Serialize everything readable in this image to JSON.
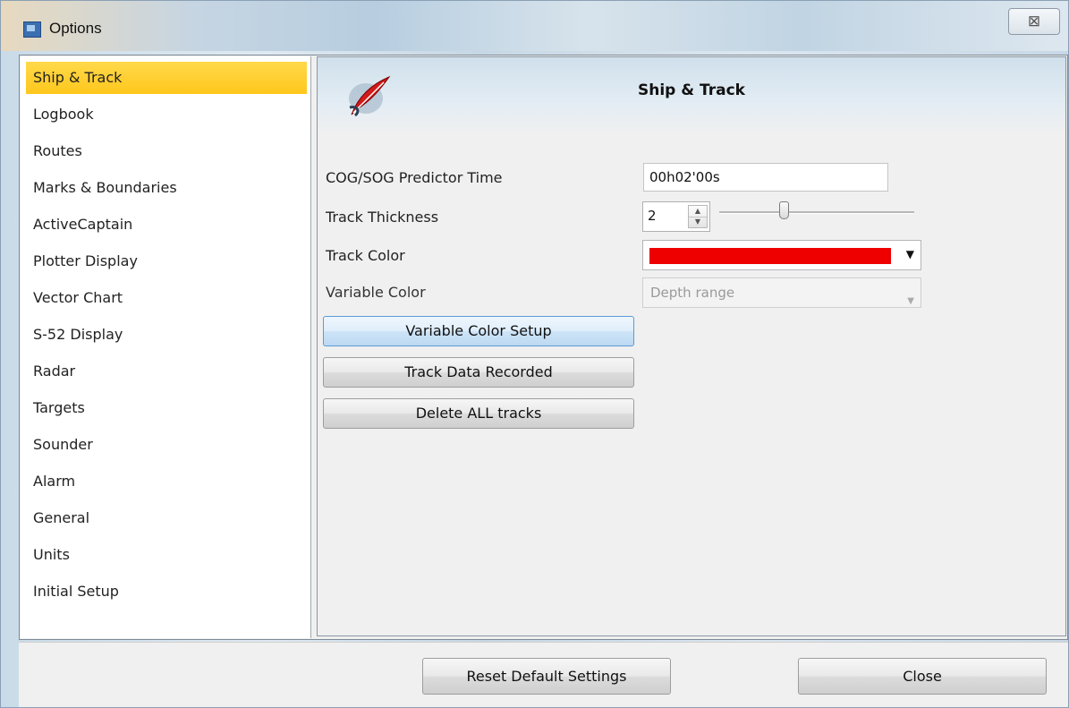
{
  "window": {
    "title": "Options",
    "close_glyph": "⊠"
  },
  "sidebar": {
    "items": [
      {
        "label": "Ship & Track",
        "selected": true
      },
      {
        "label": "Logbook"
      },
      {
        "label": "Routes"
      },
      {
        "label": "Marks & Boundaries"
      },
      {
        "label": "ActiveCaptain"
      },
      {
        "label": "Plotter Display"
      },
      {
        "label": "Vector Chart"
      },
      {
        "label": "S-52 Display"
      },
      {
        "label": "Radar"
      },
      {
        "label": "Targets"
      },
      {
        "label": "Sounder"
      },
      {
        "label": "Alarm"
      },
      {
        "label": "General"
      },
      {
        "label": "Units"
      },
      {
        "label": "Initial Setup"
      }
    ]
  },
  "panel": {
    "title": "Ship & Track",
    "icon": "quill-logo-icon",
    "cog_sog_label": "COG/SOG Predictor Time",
    "cog_sog_value": "00h02'00s",
    "track_thickness_label": "Track Thickness",
    "track_thickness_value": "2",
    "track_thickness_slider_fraction": 0.33,
    "track_color_label": "Track Color",
    "track_color": "#ee0000",
    "variable_color_label": "Variable Color",
    "variable_color_value": "Depth range",
    "variable_color_setup_button": "Variable Color Setup",
    "track_data_recorded_button": "Track Data Recorded",
    "delete_all_tracks_button": "Delete ALL tracks"
  },
  "footer": {
    "reset_button": "Reset Default Settings",
    "close_button": "Close"
  },
  "colors": {
    "selected_item": "#ffc71c",
    "accent_focus": "#5c9ad6"
  }
}
